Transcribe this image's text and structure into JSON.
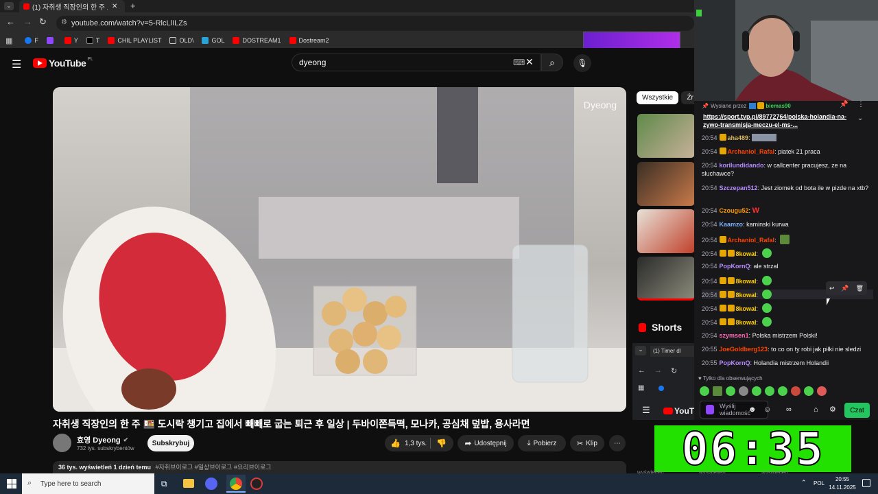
{
  "browser": {
    "tab_title": "(1) 자취생 직장인의 한 주 도",
    "url": "youtube.com/watch?v=5-RlcLlILZs",
    "bookmarks": [
      {
        "label": "F"
      },
      {
        "label": ""
      },
      {
        "label": "Y"
      },
      {
        "label": "T"
      },
      {
        "label": "CHIL PLAYLIST"
      },
      {
        "label": "OLD\\"
      },
      {
        "label": "GOL"
      },
      {
        "label": "DOSTREAM1"
      },
      {
        "label": "Dostream2"
      }
    ]
  },
  "youtube": {
    "logo_text": "YouTube",
    "country_code": "PL",
    "search_query": "dyeong",
    "video": {
      "watermark": "Dyeong",
      "title": "자취생 직장인의 한 주 🍱 도시락 챙기고 집에서 빼빼로 굽는 퇴근 후 일상 | 두바이쫀득떡, 모나카, 공심채 덮밥, 용사라면",
      "channel_name": "효영 Dyeong",
      "subscribers": "732 tys. subskrybentów",
      "subscribe_label": "Subskrybuj",
      "likes": "1,3 tys.",
      "share_label": "Udostępnij",
      "download_label": "Pobierz",
      "clip_label": "Klip",
      "views_line": "36 tys. wyświetleń  1 dzień temu",
      "hashtags": "#자취브이로그 #일상브이로그 #요리브이로그"
    },
    "sidebar": {
      "chips": [
        "Wszystkie",
        "Źr"
      ],
      "shorts_label": "Shorts"
    }
  },
  "chat": {
    "pinned_label": "Wysłane przez",
    "pinned_user": "biemas90",
    "pinned_link": "https://sport.tvp.pl/89772764/polska-holandia-na-zywo-transmisja-meczu-el-ms-...",
    "messages": [
      {
        "time": "20:54",
        "user": "aha489",
        "text": "",
        "color": "#d9b95a"
      },
      {
        "time": "20:54",
        "user": "Archaniol_Rafal",
        "text": "piatek 21 praca",
        "color": "#ff4500"
      },
      {
        "time": "20:54",
        "user": "korilundidando",
        "text": "w callcenter pracujesz, ze na sluchawce?",
        "color": "#b68dff"
      },
      {
        "time": "20:54",
        "user": "Szczepan512",
        "text": "Jest ziomek od bota ile w pizde na xtb?",
        "color": "#b68dff"
      },
      {
        "time": "20:54",
        "user": "Czougu52",
        "text": "W",
        "color": "#ff9900"
      },
      {
        "time": "20:54",
        "user": "Kaamzo",
        "text": "kaminski kurwa",
        "color": "#7fb3ff"
      },
      {
        "time": "20:54",
        "user": "Archaniol_Rafal",
        "text": "",
        "color": "#ff4500"
      },
      {
        "time": "20:54",
        "user": "8kowal",
        "text": "",
        "color": "#ffcc00"
      },
      {
        "time": "20:54",
        "user": "PopKornQ",
        "text": "ale strzal",
        "color": "#b68dff"
      },
      {
        "time": "20:54",
        "user": "8kowal",
        "text": "",
        "color": "#ffcc00"
      },
      {
        "time": "20:54",
        "user": "8kowal",
        "text": "",
        "color": "#ffcc00"
      },
      {
        "time": "20:54",
        "user": "8kowal",
        "text": "",
        "color": "#ffcc00"
      },
      {
        "time": "20:54",
        "user": "8kowal",
        "text": "",
        "color": "#ffcc00"
      },
      {
        "time": "20:54",
        "user": "szymsen1",
        "text": "Polska mistrzem Polski!",
        "color": "#ff69b4"
      },
      {
        "time": "20:55",
        "user": "JoeGoldberg123",
        "text": "to co on ty robi jak piłki nie sledzi",
        "color": "#ff4500"
      },
      {
        "time": "20:55",
        "user": "PopKornQ",
        "text": "Holandia mistrzem Holandii",
        "color": "#b68dff"
      }
    ],
    "followers_only": "Tylko dla obserwujących",
    "input_placeholder": "Wyślij wiadomość",
    "send_label": "Czat"
  },
  "mini_browser": {
    "tab_title": "(1) Timer dl",
    "logo_text": "YouTu"
  },
  "timer": {
    "display": "06:35",
    "views_label": "wyświetleń"
  },
  "taskbar": {
    "search_placeholder": "Type here to search",
    "language": "POL",
    "time": "20:55",
    "date": "14.11.2025"
  },
  "colors": {
    "youtube_red": "#ff0000",
    "twitch_purple": "#9147ff",
    "chat_bg": "#18181b",
    "timer_green": "#22e000",
    "czat_green": "#22c55e"
  }
}
